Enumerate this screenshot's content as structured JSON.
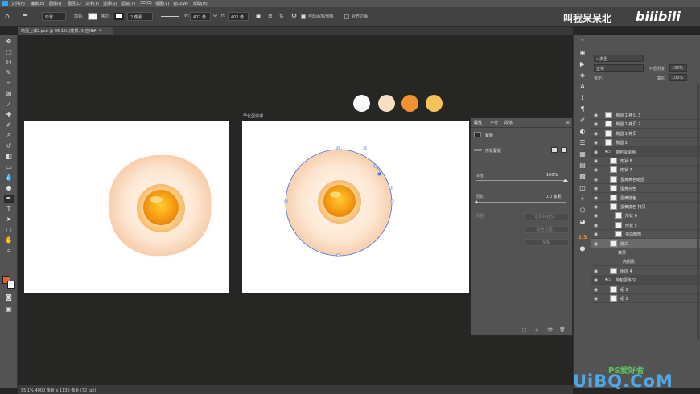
{
  "menu": [
    "文件(F)",
    "编辑(E)",
    "图像(I)",
    "图层(L)",
    "文字(Y)",
    "选择(S)",
    "滤镜(T)",
    "3D(D)",
    "视图(V)",
    "窗口(W)",
    "帮助(H)"
  ],
  "options": {
    "mode": "形状",
    "fill_label": "填充:",
    "stroke_label": "描边:",
    "stroke_width": "2 像素",
    "w_label": "W:",
    "w_value": "402 像",
    "h_label": "H:",
    "h_value": "402 像",
    "auto_add_delete": "自动添加/删除",
    "align_edges": "对齐边缘"
  },
  "watermark_top": "叫我呆呆北",
  "watermark_bilibili": "bilibili",
  "document_tab": "鸡蛋上课2.psd @ 95.1% (底部, 对应/8#) *",
  "artboard_label": "早化蛋讲课",
  "colors": {
    "swatch1": "#fafafa",
    "swatch2": "#f7dfc1",
    "swatch3": "#ef922f",
    "swatch4": "#f5c35a",
    "accent": "#e8603a"
  },
  "status": "95.1% 4000 像素 x 1130 像素 (72 ppi)",
  "properties": {
    "tabs": [
      "属性",
      "字符",
      "段落"
    ],
    "title": "蒙版",
    "mask_label": "形状蒙版",
    "density_label": "浓度:",
    "density_value": "100%",
    "feather_label": "羽化:",
    "feather_value": "0.0 像素",
    "refine_label": "调整:",
    "btn_select_mask": "选择并遮住...",
    "btn_color_range": "颜色范围...",
    "btn_invert": "反相"
  },
  "layers_panel": {
    "kind": "类型",
    "blend": "正常",
    "opacity_label": "不透明度:",
    "opacity_value": "100%",
    "lock_label": "锁定:",
    "fill_label": "填充:",
    "fill_value": "100%",
    "rows": [
      {
        "name": "椭圆 1 拷贝 3",
        "type": "layer",
        "indent": 0
      },
      {
        "name": "椭圆 1 拷贝 2",
        "type": "layer",
        "indent": 0
      },
      {
        "name": "椭圆 1 拷贝",
        "type": "layer",
        "indent": 0
      },
      {
        "name": "椭圆 1",
        "type": "layer",
        "indent": 0
      },
      {
        "name": "荷包蛋绘画",
        "type": "group",
        "indent": 0
      },
      {
        "name": "形状 8",
        "type": "layer",
        "indent": 1
      },
      {
        "name": "形状 7",
        "type": "layer",
        "indent": 1
      },
      {
        "name": "蛋黄高色暗部",
        "type": "layer",
        "indent": 1
      },
      {
        "name": "蛋黄亮色",
        "type": "layer",
        "indent": 1
      },
      {
        "name": "蛋黄底色",
        "type": "layer",
        "indent": 1
      },
      {
        "name": "蛋黄底色 拷贝",
        "type": "layer",
        "indent": 1
      },
      {
        "name": "形状 6",
        "type": "layer",
        "indent": 2
      },
      {
        "name": "形状 5",
        "type": "layer",
        "indent": 2
      },
      {
        "name": "蛋白暗部",
        "type": "layer",
        "indent": 2
      },
      {
        "name": "底白",
        "type": "layer",
        "indent": 1,
        "selected": true
      },
      {
        "name": "效果",
        "type": "effect",
        "indent": 2
      },
      {
        "name": "内阴影",
        "type": "effect",
        "indent": 3
      },
      {
        "name": "图层 4",
        "type": "layer",
        "indent": 1
      },
      {
        "name": "荷包蛋练习",
        "type": "group",
        "indent": 0
      },
      {
        "name": "组 2",
        "type": "layer",
        "indent": 1
      },
      {
        "name": "组 2",
        "type": "layer",
        "indent": 1
      }
    ]
  },
  "watermark_bottom": "UiBQ.CoM",
  "watermark_ps": "PS爱好者"
}
